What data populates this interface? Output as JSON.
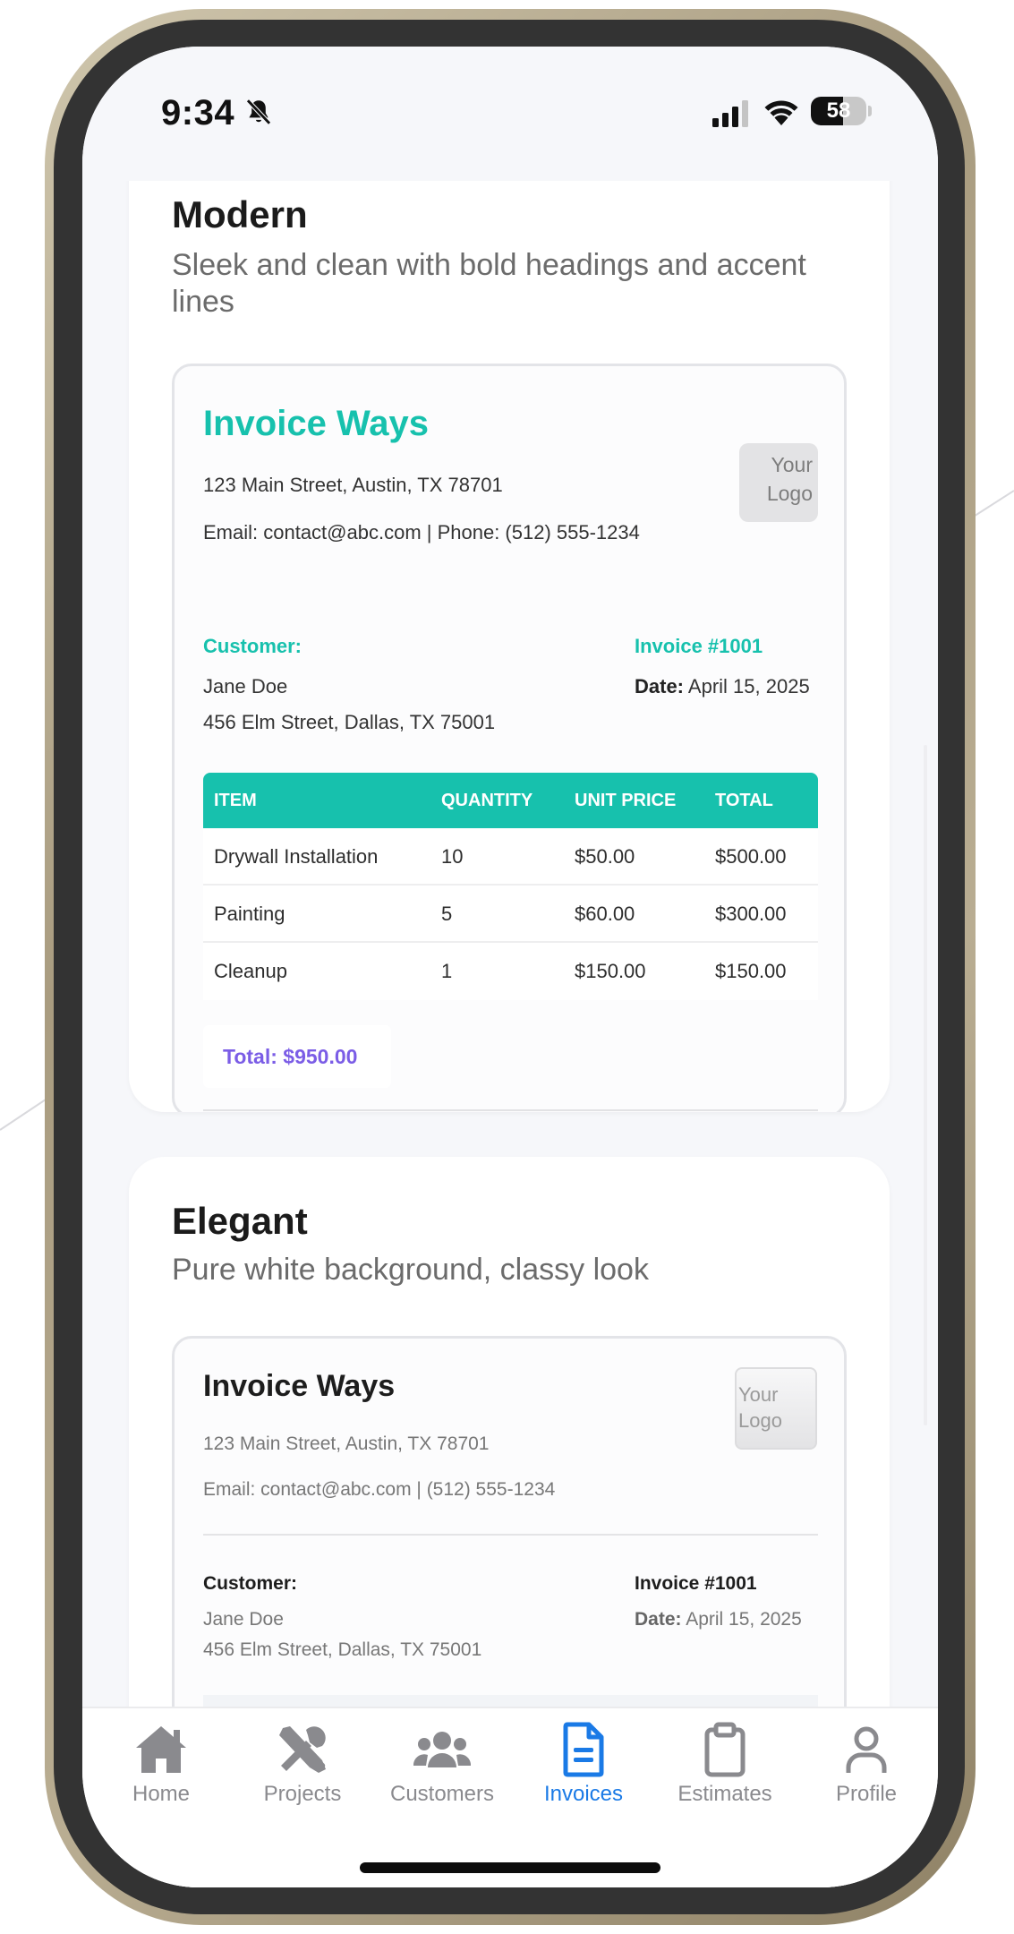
{
  "status_bar": {
    "time": "9:34",
    "battery_level": "58",
    "battery_fraction": 0.58
  },
  "templates": [
    {
      "name": "Modern",
      "description": "Sleek and clean with bold headings and accent lines",
      "accent_color": "#17c1ad",
      "total_color": "#7b5de6",
      "preview": {
        "company": "Invoice Ways",
        "address": "123 Main Street, Austin, TX 78701",
        "contact": "Email: contact@abc.com | Phone: (512) 555-1234",
        "logo_text": "Your Logo",
        "customer_label": "Customer:",
        "customer_name": "Jane Doe",
        "customer_address": "456 Elm Street, Dallas, TX 75001",
        "invoice_number": "Invoice #1001",
        "date_label": "Date:",
        "date_value": "April 15, 2025",
        "columns": [
          "ITEM",
          "QUANTITY",
          "UNIT PRICE",
          "TOTAL"
        ],
        "rows": [
          [
            "Drywall Installation",
            "10",
            "$50.00",
            "$500.00"
          ],
          [
            "Painting",
            "5",
            "$60.00",
            "$300.00"
          ],
          [
            "Cleanup",
            "1",
            "$150.00",
            "$150.00"
          ]
        ],
        "total": "Total: $950.00"
      }
    },
    {
      "name": "Elegant",
      "description": "Pure white background, classy look",
      "preview": {
        "company": "Invoice Ways",
        "address": "123 Main Street, Austin, TX 78701",
        "contact": "Email: contact@abc.com | (512) 555-1234",
        "logo_text": "Your Logo",
        "customer_label": "Customer:",
        "customer_name": "Jane Doe",
        "customer_address": "456 Elm Street, Dallas, TX 75001",
        "invoice_number": "Invoice #1001",
        "date_label": "Date:",
        "date_value": "April 15, 2025"
      }
    }
  ],
  "tab_bar": {
    "active_color": "#1a7ae6",
    "inactive_color": "#8a8a8e",
    "tabs": [
      {
        "label": "Home",
        "icon": "home-icon"
      },
      {
        "label": "Projects",
        "icon": "tools-icon"
      },
      {
        "label": "Customers",
        "icon": "users-icon"
      },
      {
        "label": "Invoices",
        "icon": "document-icon",
        "active": true
      },
      {
        "label": "Estimates",
        "icon": "clipboard-icon"
      },
      {
        "label": "Profile",
        "icon": "person-icon"
      }
    ]
  }
}
